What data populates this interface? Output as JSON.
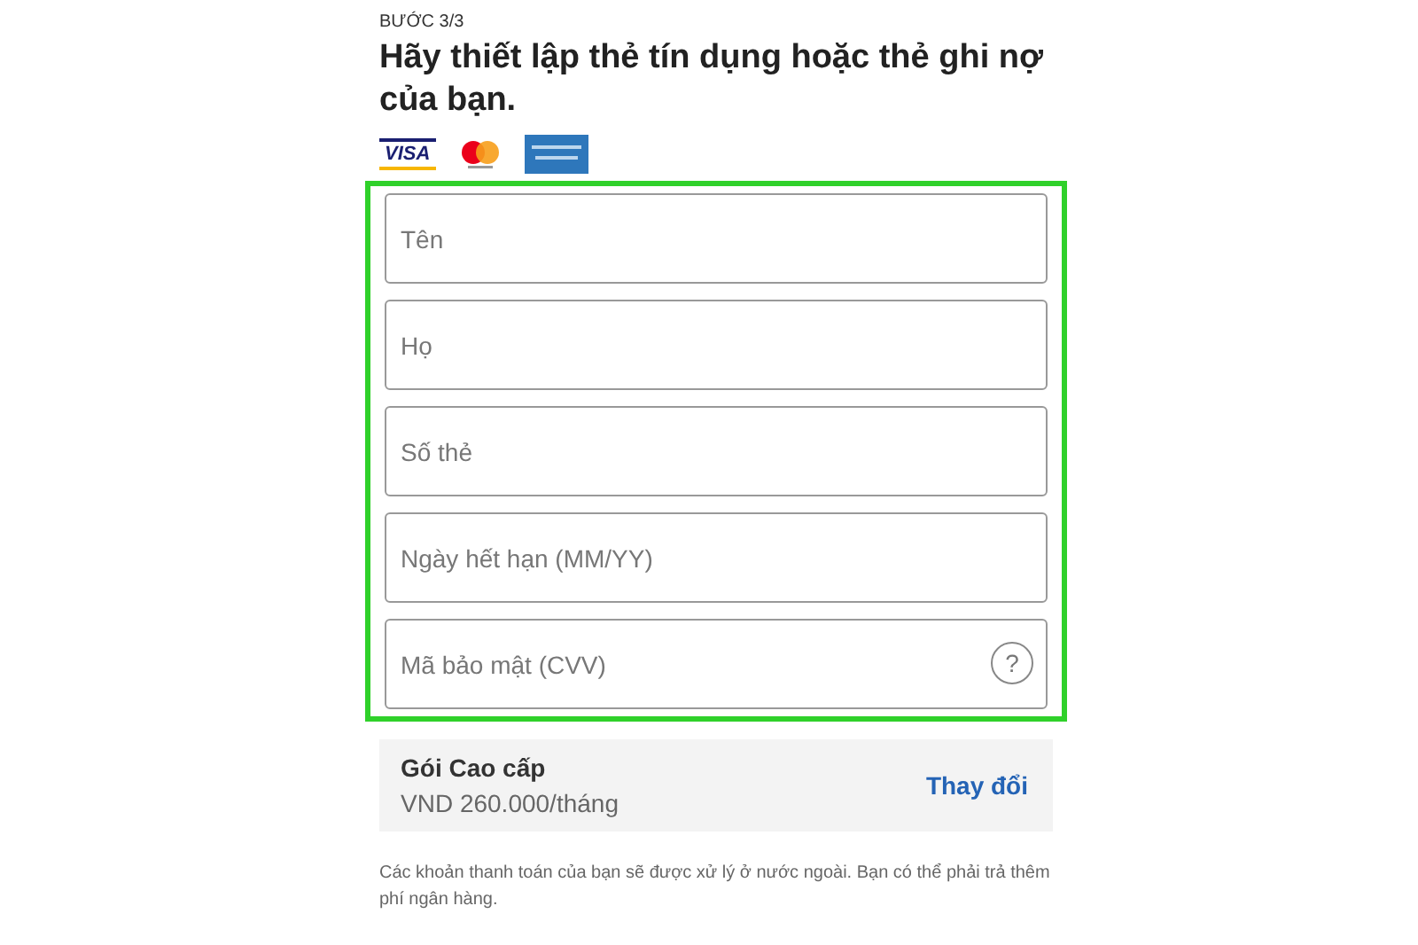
{
  "step": "BƯỚC 3/3",
  "title": "Hãy thiết lập thẻ tín dụng hoặc thẻ ghi nợ của bạn.",
  "card_logos": [
    {
      "kind": "visa",
      "label": "VISA"
    },
    {
      "kind": "mastercard"
    },
    {
      "kind": "amex"
    }
  ],
  "form": {
    "highlighted": true,
    "fields": [
      {
        "placeholder": "Tên"
      },
      {
        "placeholder": "Họ"
      },
      {
        "placeholder": "Số thẻ"
      },
      {
        "placeholder": "Ngày hết hạn (MM/YY)"
      },
      {
        "placeholder": "Mã bảo mật (CVV)",
        "help": "?"
      }
    ]
  },
  "plan": {
    "name": "Gói Cao cấp",
    "price": "VND 260.000/tháng",
    "action": "Thay đổi"
  },
  "note": "Các khoản thanh toán của bạn sẽ được xử lý ở nước ngoài. Bạn có thể phải trả thêm phí ngân hàng."
}
